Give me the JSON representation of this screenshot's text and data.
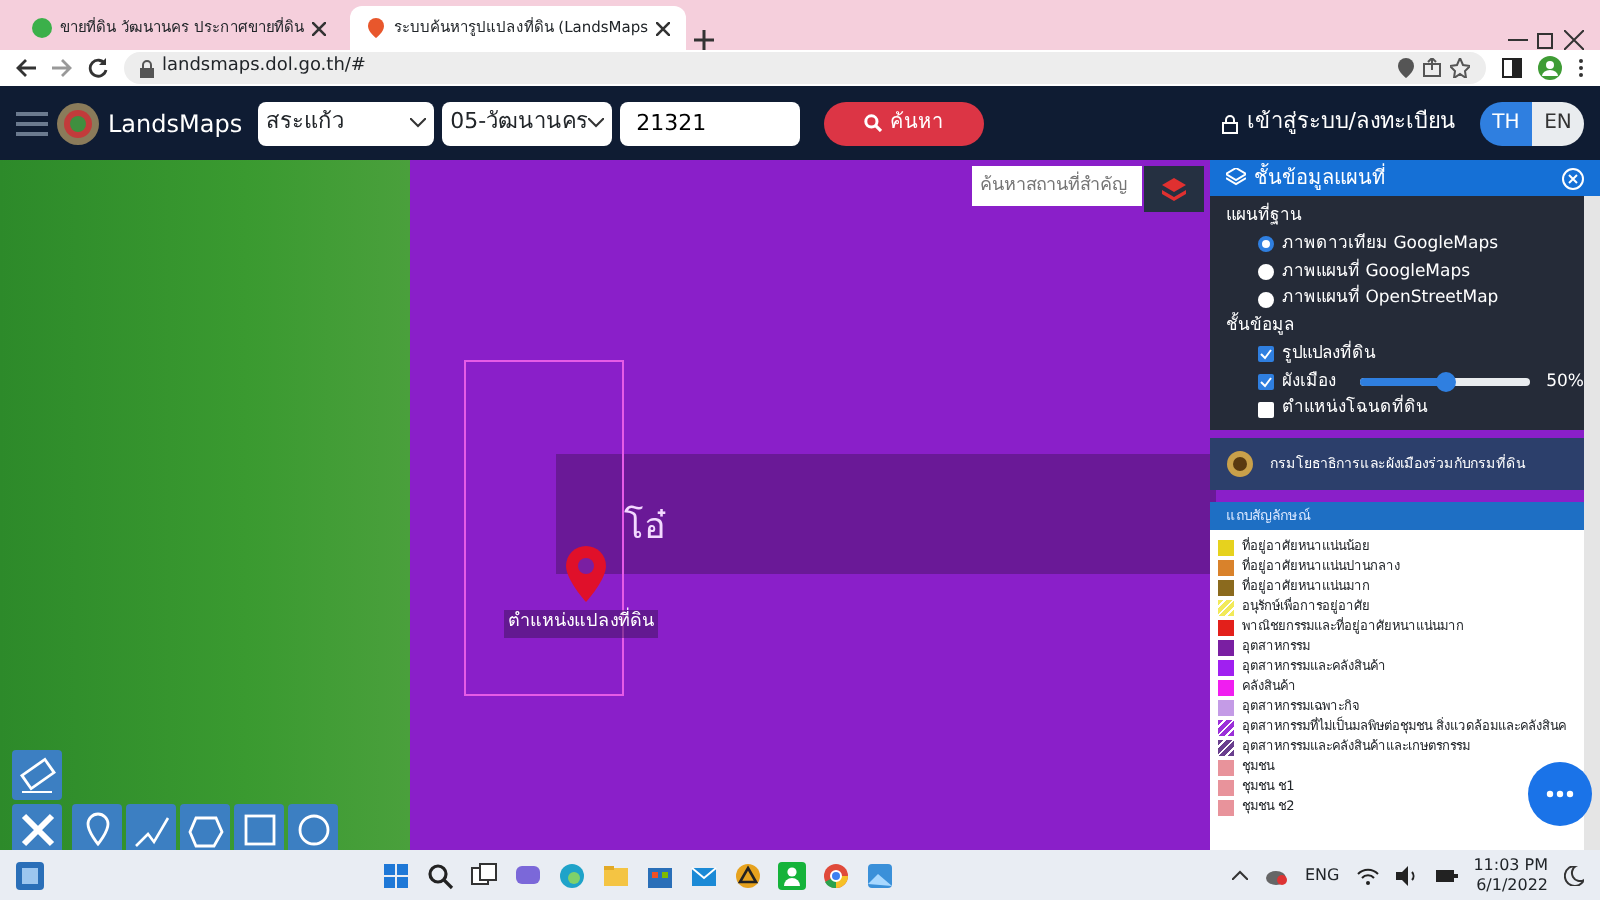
{
  "browser": {
    "tabs": [
      {
        "title": "ขายที่ดิน วัฒนานคร ประกาศขายที่ดิน",
        "selected": false
      },
      {
        "title": "ระบบค้นหารูปแปลงที่ดิน (LandsMaps",
        "selected": true
      }
    ],
    "url": "landsmaps.dol.go.th/#"
  },
  "navbar": {
    "brand": "LandsMaps",
    "province": "สระแก้ว",
    "district": "05-วัฒนานคร",
    "parcel_number": "21321",
    "search_button": "ค้นหา",
    "login": "เข้าสู่ระบบ/ลงทะเบียน",
    "languages": [
      {
        "label": "TH",
        "selected": true
      },
      {
        "label": "EN",
        "selected": false
      }
    ]
  },
  "map": {
    "place_search": {
      "placeholder": "ค้นหาสถานที่สำคัญ"
    },
    "place_label": "โอ๋",
    "marker_label": "ตำแหน่งแปลงที่ดิน"
  },
  "layers_panel": {
    "title": "ชั้นข้อมูลแผนที่",
    "base_map_heading": "แผนที่ฐาน",
    "base_maps": [
      {
        "label": "ภาพดาวเทียม GoogleMaps",
        "selected": true
      },
      {
        "label": "ภาพแผนที่ GoogleMaps",
        "selected": false
      },
      {
        "label": "ภาพแผนที่ OpenStreetMap",
        "selected": false
      }
    ],
    "layers_heading": "ชั้นข้อมูล",
    "layers": [
      {
        "kind": "plain",
        "label": "รูปแปลงที่ดิน",
        "checked": true
      },
      {
        "kind": "opacity",
        "label": "ผังเมือง",
        "checked": true,
        "level": 0.5,
        "reading": "50%"
      },
      {
        "kind": "plain",
        "label": "ตำแหน่งโฉนดที่ดิน",
        "checked": false
      }
    ],
    "agency": "กรมโยธาธิการและผังเมืองร่วมกับกรมที่ดิน",
    "legend": {
      "title": "แถบสัญลักษณ์",
      "items": [
        {
          "kind": "solid",
          "label": "ที่อยู่อาศัยหนาแน่นน้อย",
          "color": "#e6d21e"
        },
        {
          "kind": "solid",
          "label": "ที่อยู่อาศัยหนาแน่นปานกลาง",
          "color": "#d9822b"
        },
        {
          "kind": "solid",
          "label": "ที่อยู่อาศัยหนาแน่นมาก",
          "color": "#8b6a1e"
        },
        {
          "kind": "hatched",
          "label": "อนุรักษ์เพื่อการอยู่อาศัย",
          "color": "#f2ea5a"
        },
        {
          "kind": "solid",
          "label": "พาณิชยกรรมและที่อยู่อาศัยหนาแน่นมาก",
          "color": "#e3201b"
        },
        {
          "kind": "solid",
          "label": "อุตสาหกรรม",
          "color": "#7a1fa2"
        },
        {
          "kind": "solid",
          "label": "อุตสาหกรรมและคลังสินค้า",
          "color": "#a020f0"
        },
        {
          "kind": "solid",
          "label": "คลังสินค้า",
          "color": "#f01ef0"
        },
        {
          "kind": "solid",
          "label": "อุตสาหกรรมเฉพาะกิจ",
          "color": "#c49be6"
        },
        {
          "kind": "hatched",
          "label": "อุตสาหกรรมที่ไม่เป็นมลพิษต่อชุมชน สิ่งแวดล้อมและคลังสินค",
          "color": "#9b30d9"
        },
        {
          "kind": "hatched",
          "label": "อุตสาหกรรมและคลังสินค้าและเกษตรกรรม",
          "color": "#6a3f8e"
        },
        {
          "kind": "solid",
          "label": "ชุมชน",
          "color": "#e8939b"
        },
        {
          "kind": "solid",
          "label": "ชุมชน ช1",
          "color": "#e8939b"
        },
        {
          "kind": "solid",
          "label": "ชุมชน ช2",
          "color": "#e8939b"
        }
      ]
    }
  },
  "taskbar": {
    "language": "ENG",
    "time": "11:03 PM",
    "date": "6/1/2022"
  }
}
